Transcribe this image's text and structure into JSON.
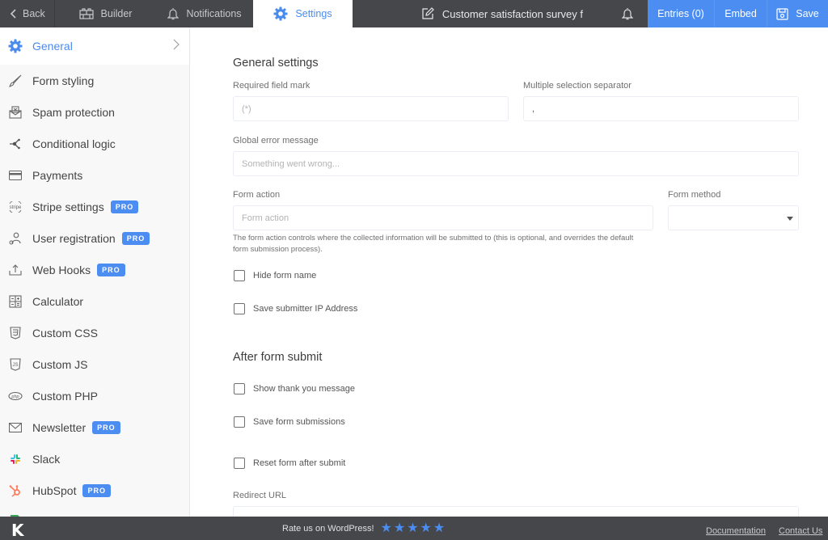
{
  "topbar": {
    "back_label": "Back",
    "builder_label": "Builder",
    "notifications_label": "Notifications",
    "settings_label": "Settings",
    "form_title": "Customer satisfaction survey f",
    "entries_label": "Entries (0)",
    "embed_label": "Embed",
    "save_label": "Save"
  },
  "sidebar": {
    "items": [
      {
        "label": "General",
        "icon": "gear-icon",
        "active": true,
        "pro": false
      },
      {
        "label": "Form styling",
        "icon": "brush-icon",
        "pro": false
      },
      {
        "label": "Spam protection",
        "icon": "spam-envelope-icon",
        "pro": false
      },
      {
        "label": "Conditional logic",
        "icon": "branch-icon",
        "pro": false
      },
      {
        "label": "Payments",
        "icon": "credit-card-icon",
        "pro": false
      },
      {
        "label": "Stripe settings",
        "icon": "stripe-icon",
        "pro": true
      },
      {
        "label": "User registration",
        "icon": "user-icon",
        "pro": true
      },
      {
        "label": "Web Hooks",
        "icon": "upload-icon",
        "pro": true
      },
      {
        "label": "Calculator",
        "icon": "calculator-icon",
        "pro": false
      },
      {
        "label": "Custom CSS",
        "icon": "css3-icon",
        "pro": false
      },
      {
        "label": "Custom JS",
        "icon": "js-icon",
        "pro": false
      },
      {
        "label": "Custom PHP",
        "icon": "php-icon",
        "pro": false
      },
      {
        "label": "Newsletter",
        "icon": "envelope-icon",
        "pro": true
      },
      {
        "label": "Slack",
        "icon": "slack-icon",
        "pro": false
      },
      {
        "label": "HubSpot",
        "icon": "hubspot-icon",
        "pro": true
      }
    ],
    "pro_badge": "PRO"
  },
  "general": {
    "title": "General settings",
    "required_mark": {
      "label": "Required field mark",
      "placeholder": "(*)",
      "value": ""
    },
    "separator": {
      "label": "Multiple selection separator",
      "value": ","
    },
    "error_message": {
      "label": "Global error message",
      "placeholder": "Something went wrong...",
      "value": ""
    },
    "form_action": {
      "label": "Form action",
      "placeholder": "Form action",
      "value": "",
      "help": "The form action controls where the collected information will be submitted to (this is optional, and overrides the default form submission process)."
    },
    "form_method": {
      "label": "Form method",
      "value": ""
    },
    "checkboxes": [
      {
        "label": "Hide form name",
        "checked": false
      },
      {
        "label": "Save submitter IP Address",
        "checked": false
      }
    ]
  },
  "after_submit": {
    "title": "After form submit",
    "checkboxes": [
      {
        "label": "Show thank you message",
        "checked": false
      },
      {
        "label": "Save form submissions",
        "checked": false
      },
      {
        "label": "Reset form after submit",
        "checked": false
      }
    ],
    "redirect_url": {
      "label": "Redirect URL",
      "value": ""
    }
  },
  "footer": {
    "logo": "K",
    "rate_text": "Rate us on WordPress!",
    "stars": 5,
    "documentation_label": "Documentation",
    "contact_label": "Contact Us"
  },
  "colors": {
    "accent": "#4b8df0",
    "topbar_bg": "#46474b",
    "sidebar_bg": "#f8f8f9",
    "hubspot": "#ff7a59"
  }
}
